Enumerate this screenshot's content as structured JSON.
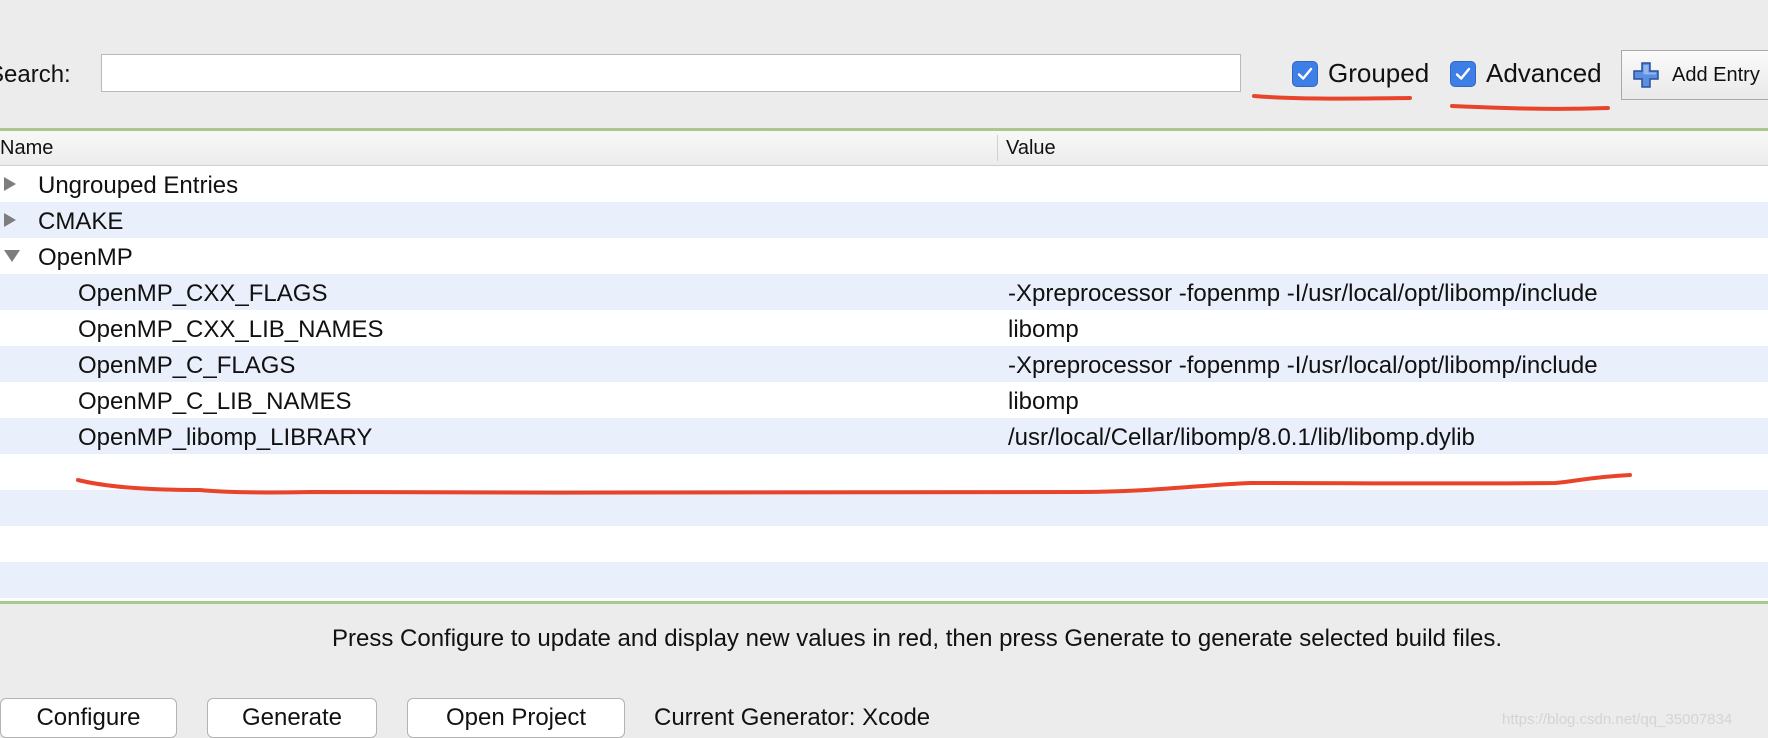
{
  "toolbar": {
    "search_label": "Search:",
    "search_value": "",
    "grouped_label": "Grouped",
    "grouped_checked": true,
    "advanced_label": "Advanced",
    "advanced_checked": true,
    "add_entry_label": "Add Entry"
  },
  "table": {
    "columns": [
      "Name",
      "Value"
    ],
    "groups": [
      {
        "label": "Ungrouped Entries",
        "expanded": false
      },
      {
        "label": "CMAKE",
        "expanded": false
      },
      {
        "label": "OpenMP",
        "expanded": true
      }
    ],
    "entries": [
      {
        "name": "OpenMP_CXX_FLAGS",
        "value": "-Xpreprocessor -fopenmp -I/usr/local/opt/libomp/include"
      },
      {
        "name": "OpenMP_CXX_LIB_NAMES",
        "value": "libomp"
      },
      {
        "name": "OpenMP_C_FLAGS",
        "value": "-Xpreprocessor -fopenmp -I/usr/local/opt/libomp/include"
      },
      {
        "name": "OpenMP_C_LIB_NAMES",
        "value": "libomp"
      },
      {
        "name": "OpenMP_libomp_LIBRARY",
        "value": "/usr/local/Cellar/libomp/8.0.1/lib/libomp.dylib"
      }
    ]
  },
  "footer": {
    "hint": "Press Configure to update and display new values in red, then press Generate to generate selected build files.",
    "configure_label": "Configure",
    "generate_label": "Generate",
    "open_project_label": "Open Project",
    "current_generator": "Current Generator: Xcode",
    "watermark": "https://blog.csdn.net/qq_35007834"
  },
  "colors": {
    "checkbox_accent": "#3d7fe6",
    "annotation_red": "#e8442a",
    "row_alt": "#e9f0fb",
    "table_border_green": "#a9c98c"
  },
  "icons": {
    "checkbox": "checkmark-icon",
    "add": "plus-icon",
    "collapsed": "triangle-right-icon",
    "expanded": "triangle-down-icon"
  }
}
